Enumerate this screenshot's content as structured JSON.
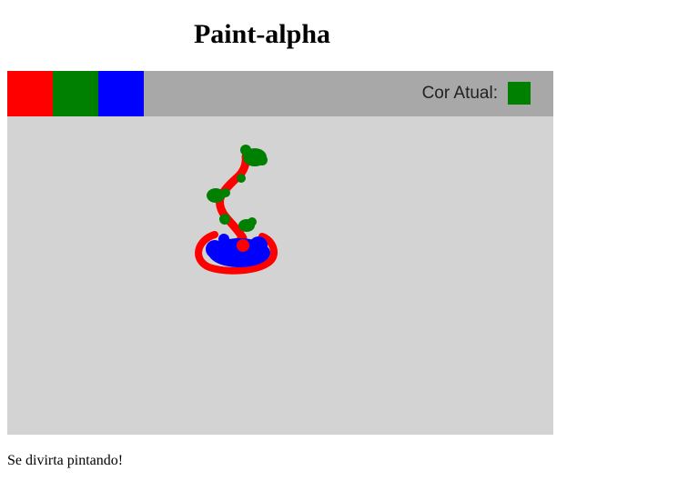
{
  "page": {
    "title": "Paint-alpha",
    "footer_text": "Se divirta pintando!"
  },
  "toolbar": {
    "palette": [
      {
        "name": "red",
        "color": "#ff0000"
      },
      {
        "name": "green",
        "color": "#008000"
      },
      {
        "name": "blue",
        "color": "#0000ff"
      }
    ],
    "current_color_label": "Cor Atual:",
    "current_color": "#008000"
  },
  "colors": {
    "toolbar_bg": "#a8a8a8",
    "canvas_bg": "#d3d3d3"
  }
}
